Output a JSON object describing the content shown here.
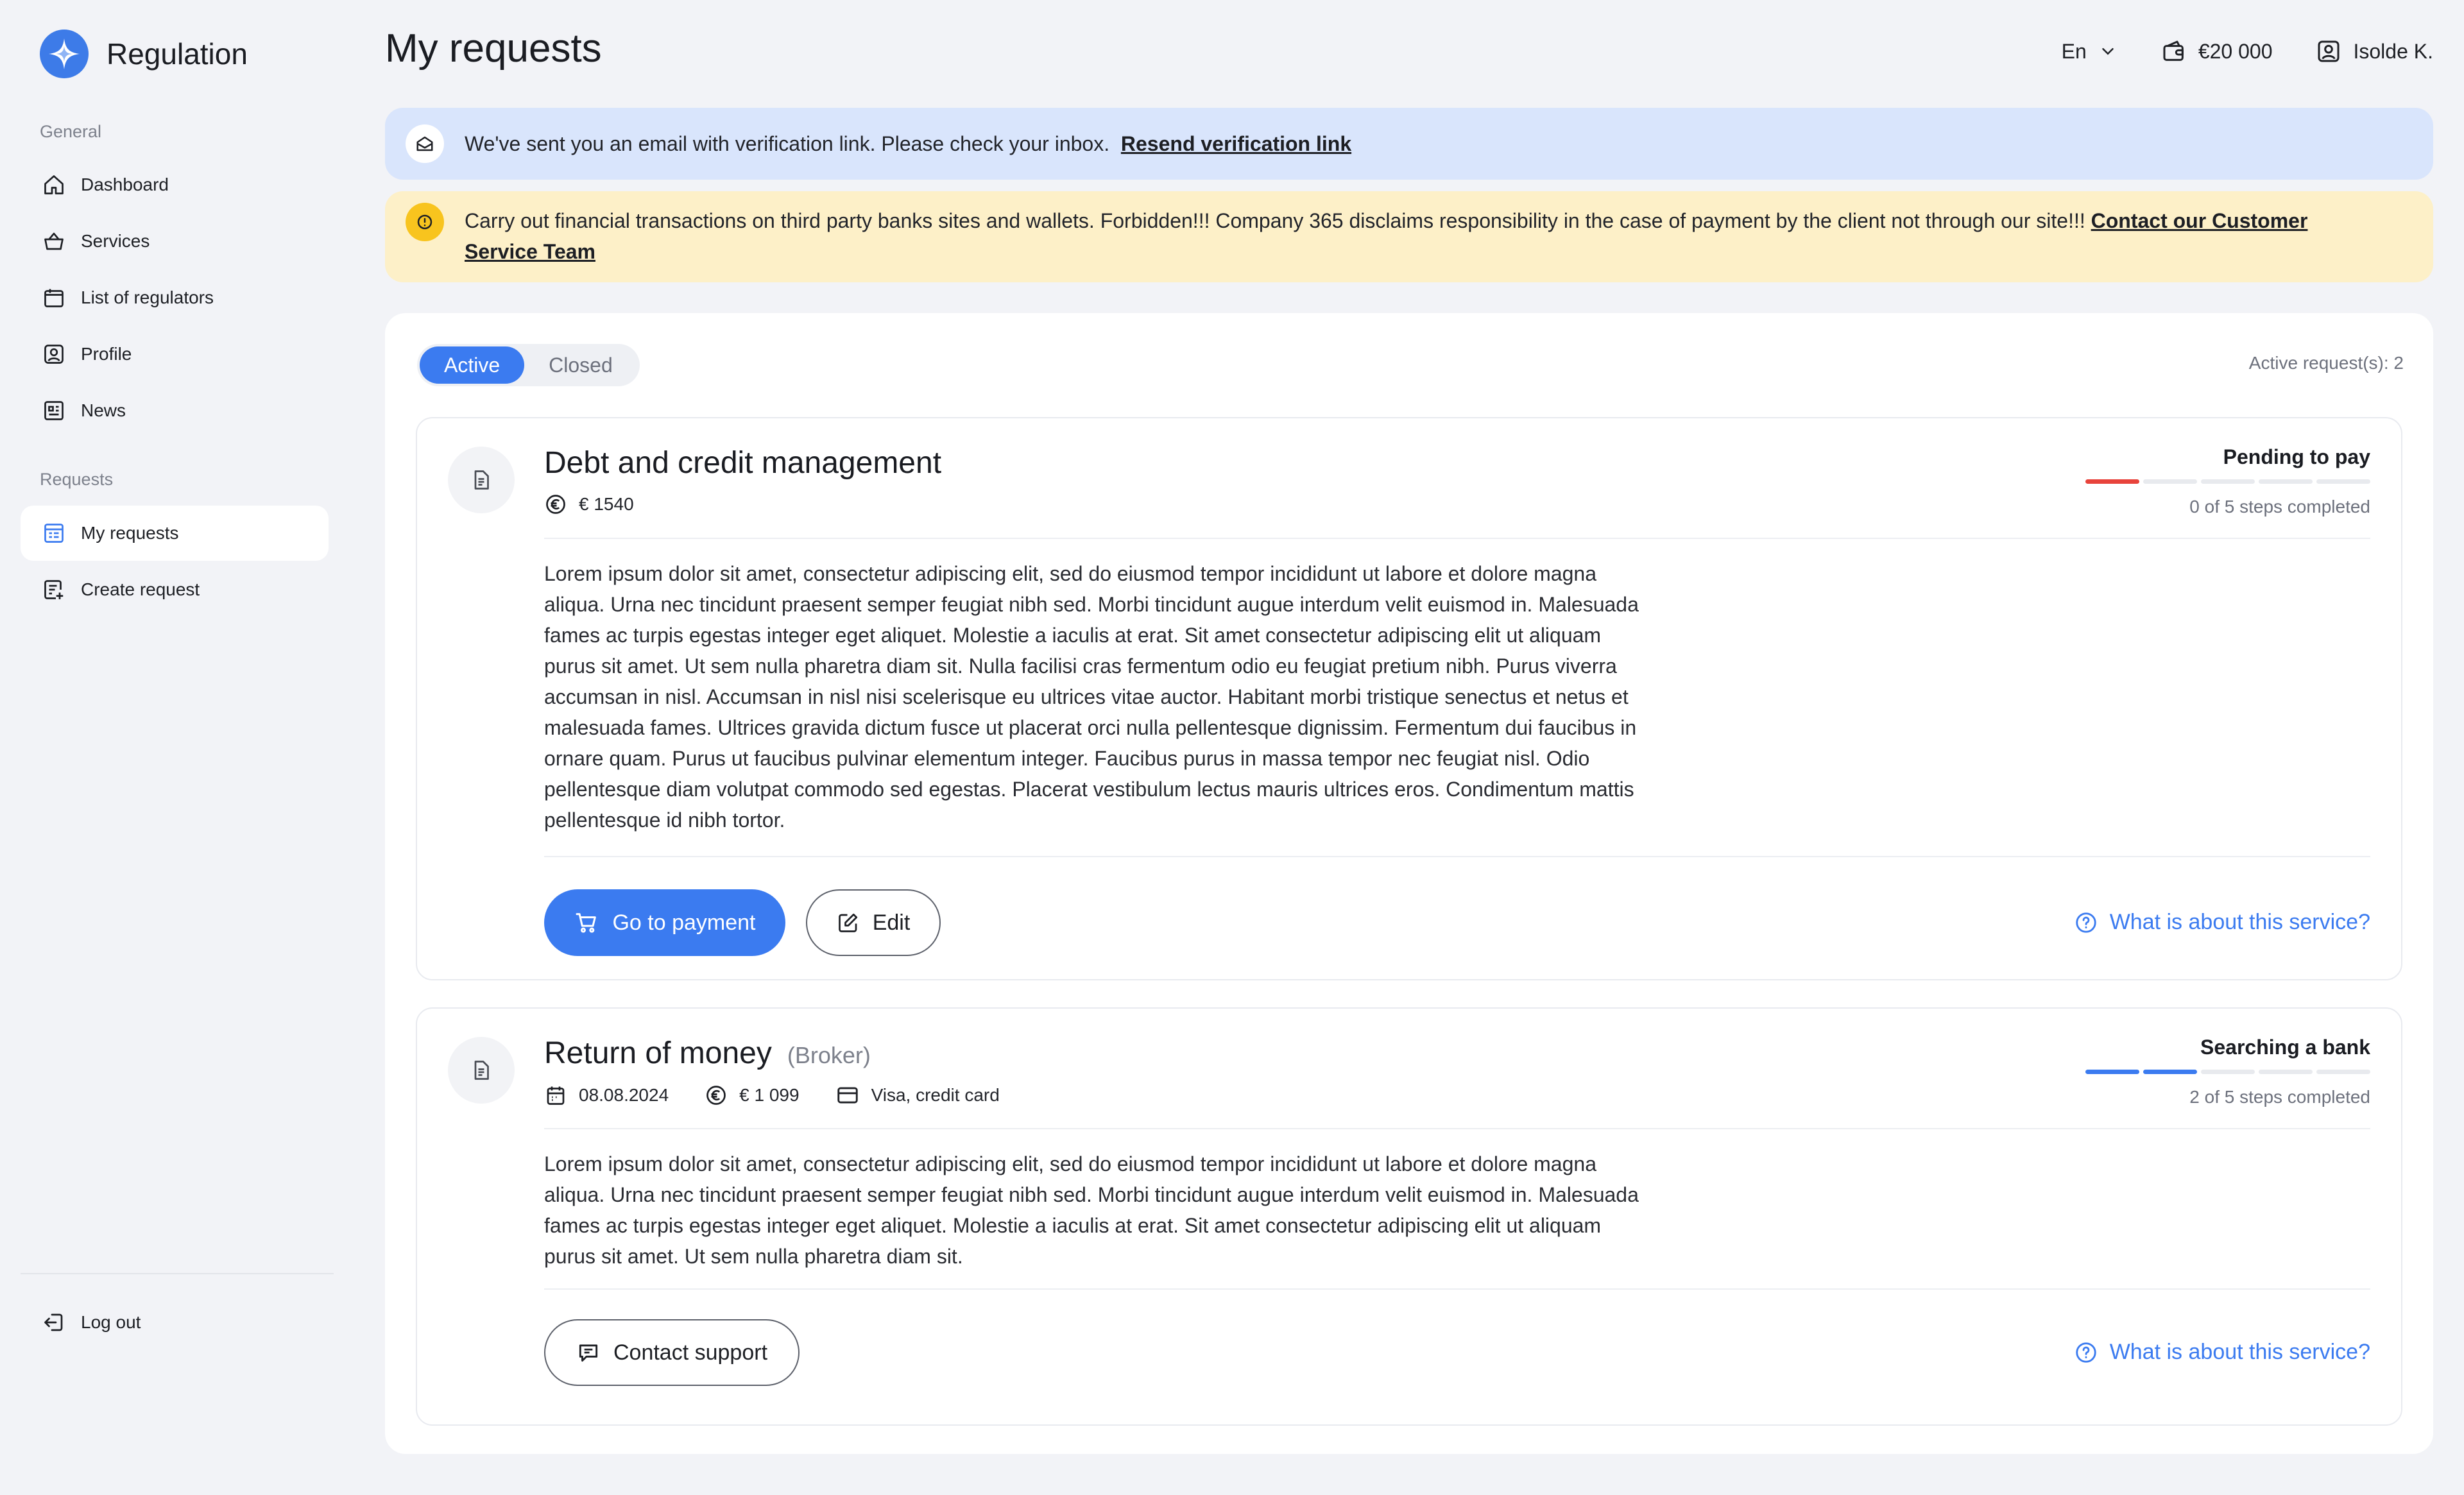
{
  "app": {
    "name": "Regulation"
  },
  "colors": {
    "accent": "#3b7bf0",
    "progress_pending": "#e8433b",
    "info_banner": "#d9e5fc",
    "warning_banner": "#fdf0c8",
    "warning_icon": "#f8c41e"
  },
  "sidebar": {
    "general_label": "General",
    "general_items": [
      {
        "label": "Dashboard",
        "icon": "home-icon"
      },
      {
        "label": "Services",
        "icon": "basket-icon"
      },
      {
        "label": "List of regulators",
        "icon": "folder-icon"
      },
      {
        "label": "Profile",
        "icon": "user-icon"
      },
      {
        "label": "News",
        "icon": "news-icon"
      }
    ],
    "requests_label": "Requests",
    "requests_items": [
      {
        "label": "My requests",
        "icon": "requests-icon",
        "active": true
      },
      {
        "label": "Create request",
        "icon": "create-request-icon"
      }
    ],
    "logout_label": "Log out"
  },
  "header": {
    "title": "My requests",
    "language": "En",
    "balance": "€20 000",
    "user": "Isolde K."
  },
  "banners": {
    "verification": {
      "text": "We've sent you an email with verification link. Please check your inbox.",
      "link": "Resend verification link"
    },
    "warning": {
      "text": "Carry out financial transactions on third party banks sites and wallets. Forbidden!!! Company 365 disclaims responsibility in the case of payment by the client not through our site!!! ",
      "link": "Contact our Customer Service Team"
    }
  },
  "tabs": [
    {
      "label": "Active",
      "active": true
    },
    {
      "label": "Closed",
      "active": false
    }
  ],
  "active_count": "Active request(s): 2",
  "requests": [
    {
      "title": "Debt and credit management",
      "subtitle": "",
      "amount": "€ 1540",
      "status": "Pending to pay",
      "steps_completed": 0,
      "steps_total": 5,
      "steps_text": "0 of 5 steps completed",
      "description": "Lorem ipsum dolor sit amet, consectetur adipiscing elit, sed do eiusmod tempor incididunt ut labore et dolore magna aliqua. Urna nec tincidunt praesent semper feugiat nibh sed. Morbi tincidunt augue interdum velit euismod in. Malesuada fames ac turpis egestas integer eget aliquet. Molestie a iaculis at erat. Sit amet consectetur adipiscing elit ut aliquam purus sit amet. Ut sem nulla pharetra diam sit. Nulla facilisi cras fermentum odio eu feugiat pretium nibh. Purus viverra accumsan in nisl. Accumsan in nisl nisi scelerisque eu ultrices vitae auctor. Habitant morbi tristique senectus et netus et malesuada fames. Ultrices gravida dictum fusce ut placerat orci nulla pellentesque dignissim. Fermentum dui faucibus in ornare quam. Purus ut faucibus pulvinar elementum integer. Faucibus purus in massa tempor nec feugiat nisl. Odio pellentesque diam volutpat commodo sed egestas. Placerat vestibulum lectus mauris ultrices eros. Condimentum mattis pellentesque id nibh tortor.",
      "primary_button": "Go to payment",
      "secondary_button": "Edit",
      "help_link": "What is about this service?"
    },
    {
      "title": "Return of money",
      "subtitle": "(Broker)",
      "date": "08.08.2024",
      "amount": "€ 1 099",
      "payment_method": "Visa, credit card",
      "status": "Searching a bank",
      "steps_completed": 2,
      "steps_total": 5,
      "steps_text": "2 of 5 steps completed",
      "description": "Lorem ipsum dolor sit amet, consectetur adipiscing elit, sed do eiusmod tempor incididunt ut labore et dolore magna aliqua. Urna nec tincidunt praesent semper feugiat nibh sed. Morbi tincidunt augue interdum velit euismod in. Malesuada fames ac turpis egestas integer eget aliquet. Molestie a iaculis at erat. Sit amet consectetur adipiscing elit ut aliquam purus sit amet. Ut sem nulla pharetra diam sit.",
      "secondary_button": "Contact support",
      "help_link": "What is about this service?"
    }
  ]
}
